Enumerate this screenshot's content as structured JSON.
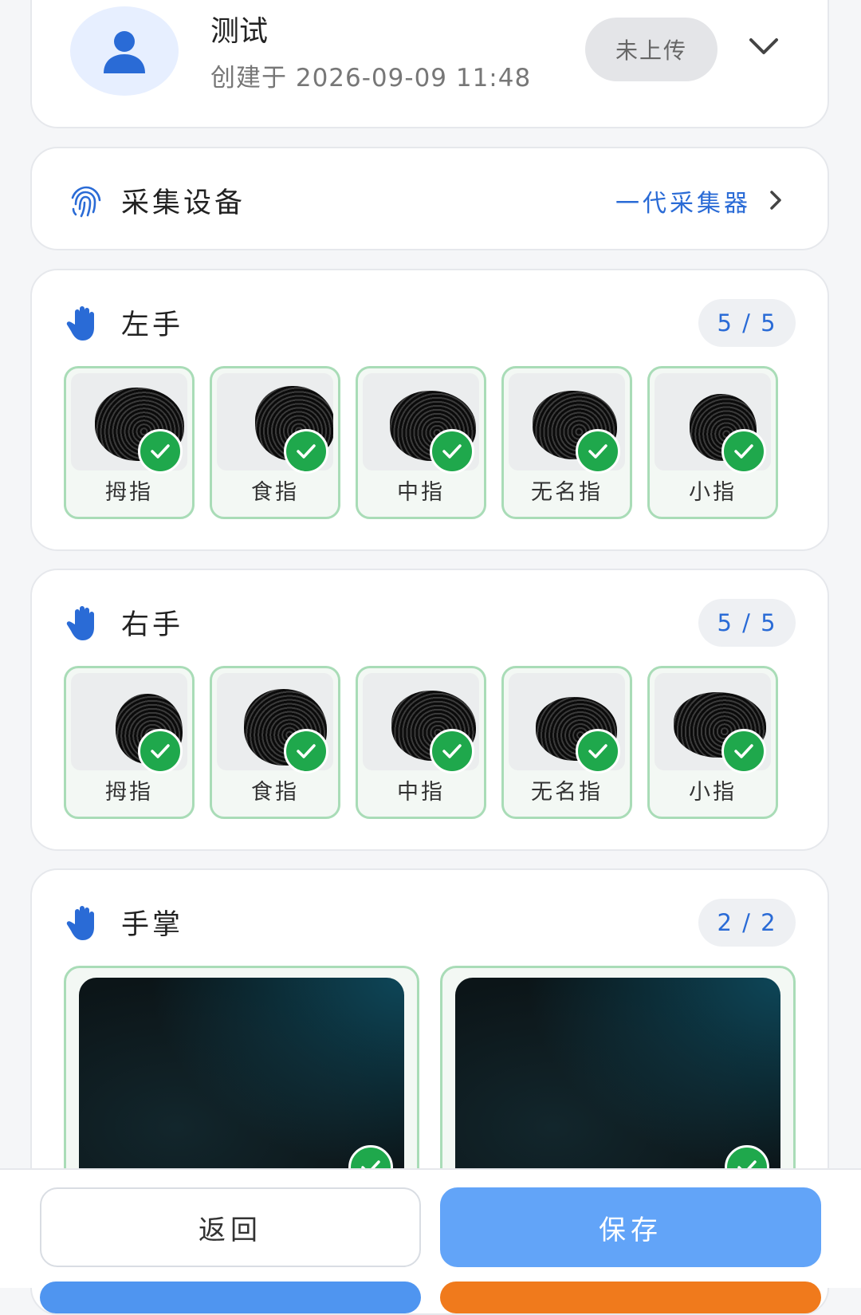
{
  "profile": {
    "name": "测试",
    "created": "创建于 2026-09-09 11:48",
    "status": "未上传",
    "icons": {
      "avatar": "person-icon",
      "expand": "chevron-down-icon"
    }
  },
  "device": {
    "label": "采集设备",
    "value": "一代采集器",
    "icons": {
      "device": "fingerprint-icon",
      "next": "chevron-right-icon"
    }
  },
  "left_hand": {
    "title": "左手",
    "count": "5 / 5",
    "fingers": [
      {
        "label": "拇指",
        "captured": true
      },
      {
        "label": "食指",
        "captured": true
      },
      {
        "label": "中指",
        "captured": true
      },
      {
        "label": "无名指",
        "captured": true
      },
      {
        "label": "小指",
        "captured": true
      }
    ]
  },
  "right_hand": {
    "title": "右手",
    "count": "5 / 5",
    "fingers": [
      {
        "label": "拇指",
        "captured": true
      },
      {
        "label": "食指",
        "captured": true
      },
      {
        "label": "中指",
        "captured": true
      },
      {
        "label": "无名指",
        "captured": true
      },
      {
        "label": "小指",
        "captured": true
      }
    ]
  },
  "palm": {
    "title": "手掌",
    "count": "2 / 2",
    "images": [
      {
        "captured": true
      },
      {
        "captured": true
      }
    ]
  },
  "actions": {
    "back": "返回",
    "save": "保存"
  },
  "colors": {
    "accent": "#2a6bd6",
    "success": "#1fa84c",
    "primary_button": "#62a4f8",
    "secondary_accent": "#f07a1c"
  }
}
